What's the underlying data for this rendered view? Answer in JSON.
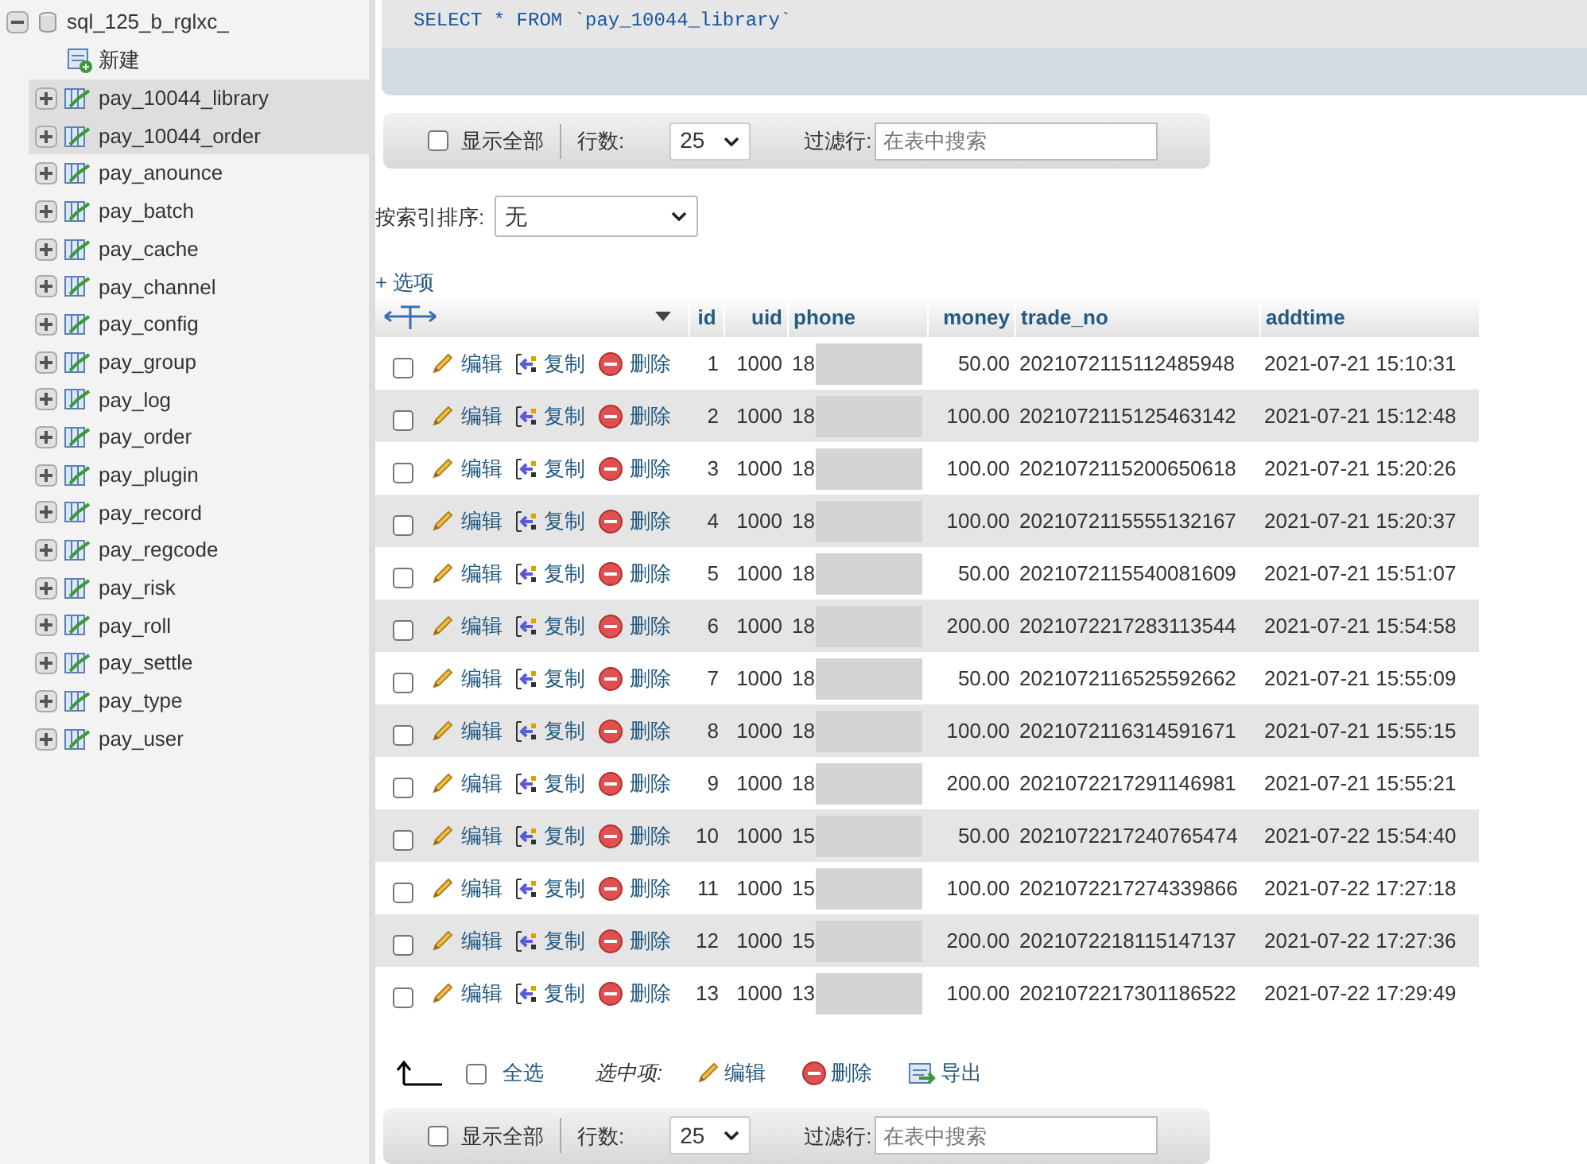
{
  "sidebar": {
    "database": {
      "name": "sql_125_b_rglxc_",
      "expanded": true
    },
    "new_item": "新建",
    "tables": [
      {
        "name": "pay_10044_library",
        "selected": true
      },
      {
        "name": "pay_10044_order",
        "selected": true
      },
      {
        "name": "pay_anounce",
        "selected": false
      },
      {
        "name": "pay_batch",
        "selected": false
      },
      {
        "name": "pay_cache",
        "selected": false
      },
      {
        "name": "pay_channel",
        "selected": false
      },
      {
        "name": "pay_config",
        "selected": false
      },
      {
        "name": "pay_group",
        "selected": false
      },
      {
        "name": "pay_log",
        "selected": false
      },
      {
        "name": "pay_order",
        "selected": false
      },
      {
        "name": "pay_plugin",
        "selected": false
      },
      {
        "name": "pay_record",
        "selected": false
      },
      {
        "name": "pay_regcode",
        "selected": false
      },
      {
        "name": "pay_risk",
        "selected": false
      },
      {
        "name": "pay_roll",
        "selected": false
      },
      {
        "name": "pay_settle",
        "selected": false
      },
      {
        "name": "pay_type",
        "selected": false
      },
      {
        "name": "pay_user",
        "selected": false
      }
    ]
  },
  "query": {
    "sql": "SELECT * FROM `pay_10044_library`"
  },
  "top_toolbar": {
    "show_all_label": "显示全部",
    "show_all_checked": false,
    "rows_label": "行数:",
    "rows_value": "25",
    "filter_label": "过滤行:",
    "filter_placeholder": "在表中搜索"
  },
  "sort": {
    "label": "按索引排序:",
    "value": "无"
  },
  "options_link": "+ 选项",
  "table": {
    "columns": [
      "id",
      "uid",
      "phone",
      "money",
      "trade_no",
      "addtime"
    ],
    "rows": [
      {
        "checked": false,
        "actions": [
          "编辑",
          "复制",
          "删除"
        ],
        "cells": [
          "1",
          "1000",
          "18",
          "50.00",
          "2021072115112485948",
          "2021-07-21 15:10:31"
        ]
      },
      {
        "checked": false,
        "actions": [
          "编辑",
          "复制",
          "删除"
        ],
        "cells": [
          "2",
          "1000",
          "18",
          "100.00",
          "2021072115125463142",
          "2021-07-21 15:12:48"
        ]
      },
      {
        "checked": false,
        "actions": [
          "编辑",
          "复制",
          "删除"
        ],
        "cells": [
          "3",
          "1000",
          "18",
          "100.00",
          "2021072115200650618",
          "2021-07-21 15:20:26"
        ]
      },
      {
        "checked": false,
        "actions": [
          "编辑",
          "复制",
          "删除"
        ],
        "cells": [
          "4",
          "1000",
          "18",
          "100.00",
          "2021072115555132167",
          "2021-07-21 15:20:37"
        ]
      },
      {
        "checked": false,
        "actions": [
          "编辑",
          "复制",
          "删除"
        ],
        "cells": [
          "5",
          "1000",
          "18",
          "50.00",
          "2021072115540081609",
          "2021-07-21 15:51:07"
        ]
      },
      {
        "checked": false,
        "actions": [
          "编辑",
          "复制",
          "删除"
        ],
        "cells": [
          "6",
          "1000",
          "18",
          "200.00",
          "2021072217283113544",
          "2021-07-21 15:54:58"
        ]
      },
      {
        "checked": false,
        "actions": [
          "编辑",
          "复制",
          "删除"
        ],
        "cells": [
          "7",
          "1000",
          "18",
          "50.00",
          "2021072116525592662",
          "2021-07-21 15:55:09"
        ]
      },
      {
        "checked": false,
        "actions": [
          "编辑",
          "复制",
          "删除"
        ],
        "cells": [
          "8",
          "1000",
          "18",
          "100.00",
          "2021072116314591671",
          "2021-07-21 15:55:15"
        ]
      },
      {
        "checked": false,
        "actions": [
          "编辑",
          "复制",
          "删除"
        ],
        "cells": [
          "9",
          "1000",
          "18",
          "200.00",
          "2021072217291146981",
          "2021-07-21 15:55:21"
        ]
      },
      {
        "checked": false,
        "actions": [
          "编辑",
          "复制",
          "删除"
        ],
        "cells": [
          "10",
          "1000",
          "15",
          "50.00",
          "2021072217240765474",
          "2021-07-22 15:54:40"
        ]
      },
      {
        "checked": false,
        "actions": [
          "编辑",
          "复制",
          "删除"
        ],
        "cells": [
          "11",
          "1000",
          "15",
          "100.00",
          "2021072217274339866",
          "2021-07-22 17:27:18"
        ]
      },
      {
        "checked": false,
        "actions": [
          "编辑",
          "复制",
          "删除"
        ],
        "cells": [
          "12",
          "1000",
          "15",
          "200.00",
          "2021072218115147137",
          "2021-07-22 17:27:36"
        ]
      },
      {
        "checked": false,
        "actions": [
          "编辑",
          "复制",
          "删除"
        ],
        "cells": [
          "13",
          "1000",
          "13",
          "100.00",
          "2021072217301186522",
          "2021-07-22 17:29:49"
        ]
      }
    ]
  },
  "bulk": {
    "select_all_label": "全选",
    "select_all_checked": false,
    "with_selected": "选中项:",
    "actions": [
      {
        "kind": "edit",
        "label": "编辑"
      },
      {
        "kind": "delete",
        "label": "删除"
      },
      {
        "kind": "export",
        "label": "导出"
      }
    ]
  },
  "bottom_toolbar": {
    "show_all_label": "显示全部",
    "show_all_checked": false,
    "rows_label": "行数:",
    "rows_value": "25",
    "filter_label": "过滤行:",
    "filter_placeholder": "在表中搜索"
  }
}
